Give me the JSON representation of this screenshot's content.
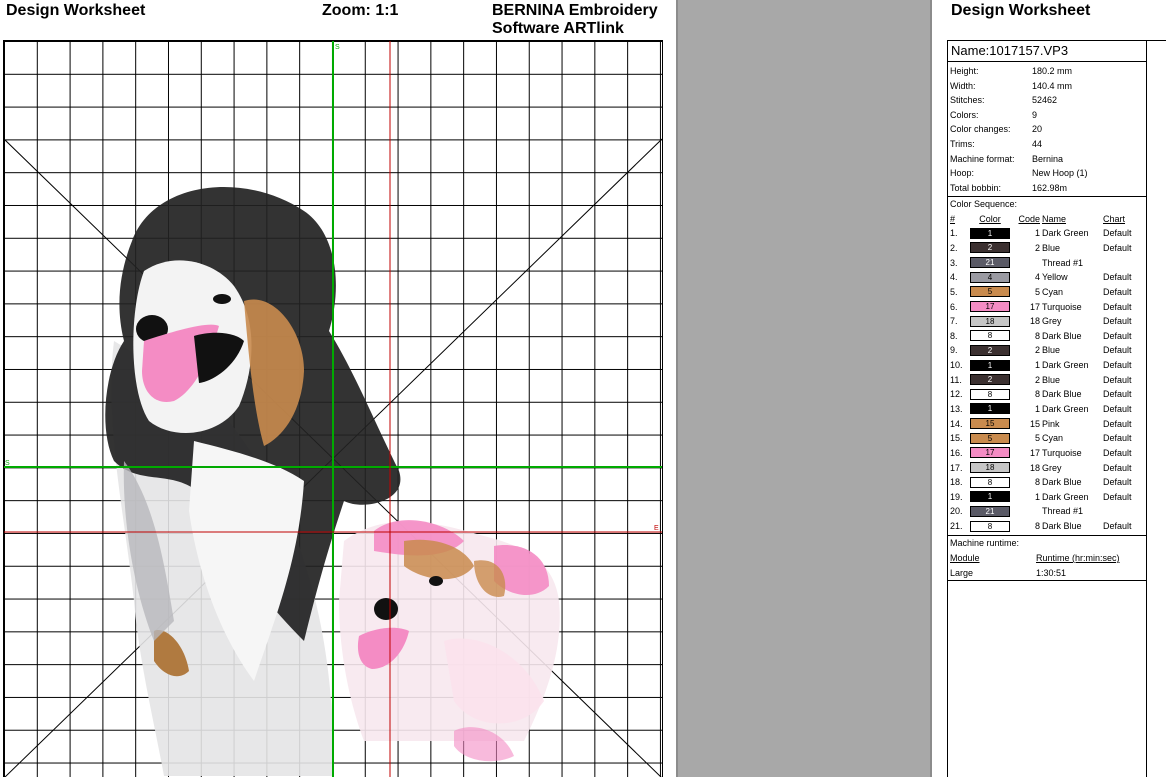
{
  "worksheet": {
    "title": "Design Worksheet",
    "zoom": "Zoom:  1:1",
    "software": "BERNINA Embroidery Software ARTlink"
  },
  "grid": {
    "axis_markers": {
      "green_vertical": "S",
      "green_horizontal": "S",
      "red_horizontal": "E"
    },
    "colors": {
      "grid": "#000000",
      "green_axis": "#00aa00",
      "red_axis": "#c00000"
    }
  },
  "panel": {
    "title": "Design Worksheet",
    "name": "Name:1017157.VP3",
    "properties": [
      {
        "label": "Height:",
        "value": "180.2 mm"
      },
      {
        "label": "Width:",
        "value": "140.4 mm"
      },
      {
        "label": "Stitches:",
        "value": "52462"
      },
      {
        "label": "Colors:",
        "value": "9"
      },
      {
        "label": "Color changes:",
        "value": "20"
      },
      {
        "label": "Trims:",
        "value": "44"
      },
      {
        "label": "Machine format:",
        "value": "Bernina"
      },
      {
        "label": "Hoop:",
        "value": "New Hoop (1)"
      },
      {
        "label": "Total bobbin:",
        "value": "162.98m"
      }
    ],
    "color_sequence": {
      "title": "Color Sequence:",
      "headers": {
        "num": "#",
        "color": "Color",
        "code": "Code",
        "name": "Name",
        "chart": "Chart"
      },
      "rows": [
        {
          "num": "1.",
          "swatch": "1",
          "fill": "#000000",
          "text_color": "#ffffff",
          "code": "1",
          "name": "Dark Green",
          "chart": "Default"
        },
        {
          "num": "2.",
          "swatch": "2",
          "fill": "#3b3030",
          "text_color": "#ffffff",
          "code": "2",
          "name": "Blue",
          "chart": "Default"
        },
        {
          "num": "3.",
          "swatch": "21",
          "fill": "#5a5a66",
          "text_color": "#ffffff",
          "code": "",
          "name": "Thread #1",
          "chart": ""
        },
        {
          "num": "4.",
          "swatch": "4",
          "fill": "#9a9aa2",
          "text_color": "#000000",
          "code": "4",
          "name": "Yellow",
          "chart": "Default"
        },
        {
          "num": "5.",
          "swatch": "5",
          "fill": "#c98b4e",
          "text_color": "#000000",
          "code": "5",
          "name": "Cyan",
          "chart": "Default"
        },
        {
          "num": "6.",
          "swatch": "17",
          "fill": "#f48cc4",
          "text_color": "#000000",
          "code": "17",
          "name": "Turquoise",
          "chart": "Default"
        },
        {
          "num": "7.",
          "swatch": "18",
          "fill": "#c6c6c6",
          "text_color": "#000000",
          "code": "18",
          "name": "Grey",
          "chart": "Default"
        },
        {
          "num": "8.",
          "swatch": "8",
          "fill": "#ffffff",
          "text_color": "#000000",
          "code": "8",
          "name": "Dark Blue",
          "chart": "Default"
        },
        {
          "num": "9.",
          "swatch": "2",
          "fill": "#3b3030",
          "text_color": "#ffffff",
          "code": "2",
          "name": "Blue",
          "chart": "Default"
        },
        {
          "num": "10.",
          "swatch": "1",
          "fill": "#000000",
          "text_color": "#ffffff",
          "code": "1",
          "name": "Dark Green",
          "chart": "Default"
        },
        {
          "num": "11.",
          "swatch": "2",
          "fill": "#3b3030",
          "text_color": "#ffffff",
          "code": "2",
          "name": "Blue",
          "chart": "Default"
        },
        {
          "num": "12.",
          "swatch": "8",
          "fill": "#ffffff",
          "text_color": "#000000",
          "code": "8",
          "name": "Dark Blue",
          "chart": "Default"
        },
        {
          "num": "13.",
          "swatch": "1",
          "fill": "#000000",
          "text_color": "#ffffff",
          "code": "1",
          "name": "Dark Green",
          "chart": "Default"
        },
        {
          "num": "14.",
          "swatch": "15",
          "fill": "#c98b4e",
          "text_color": "#000000",
          "code": "15",
          "name": "Pink",
          "chart": "Default"
        },
        {
          "num": "15.",
          "swatch": "5",
          "fill": "#c98b4e",
          "text_color": "#000000",
          "code": "5",
          "name": "Cyan",
          "chart": "Default"
        },
        {
          "num": "16.",
          "swatch": "17",
          "fill": "#f48cc4",
          "text_color": "#000000",
          "code": "17",
          "name": "Turquoise",
          "chart": "Default"
        },
        {
          "num": "17.",
          "swatch": "18",
          "fill": "#c6c6c6",
          "text_color": "#000000",
          "code": "18",
          "name": "Grey",
          "chart": "Default"
        },
        {
          "num": "18.",
          "swatch": "8",
          "fill": "#ffffff",
          "text_color": "#000000",
          "code": "8",
          "name": "Dark Blue",
          "chart": "Default"
        },
        {
          "num": "19.",
          "swatch": "1",
          "fill": "#000000",
          "text_color": "#ffffff",
          "code": "1",
          "name": "Dark Green",
          "chart": "Default"
        },
        {
          "num": "20.",
          "swatch": "21",
          "fill": "#5a5a66",
          "text_color": "#ffffff",
          "code": "",
          "name": "Thread #1",
          "chart": ""
        },
        {
          "num": "21.",
          "swatch": "8",
          "fill": "#ffffff",
          "text_color": "#000000",
          "code": "8",
          "name": "Dark Blue",
          "chart": "Default"
        }
      ]
    },
    "runtime": {
      "title": "Machine runtime:",
      "headers": {
        "module": "Module",
        "runtime": "Runtime (hr:min:sec)"
      },
      "rows": [
        {
          "module": "Large",
          "runtime": "1:30:51"
        }
      ]
    }
  }
}
